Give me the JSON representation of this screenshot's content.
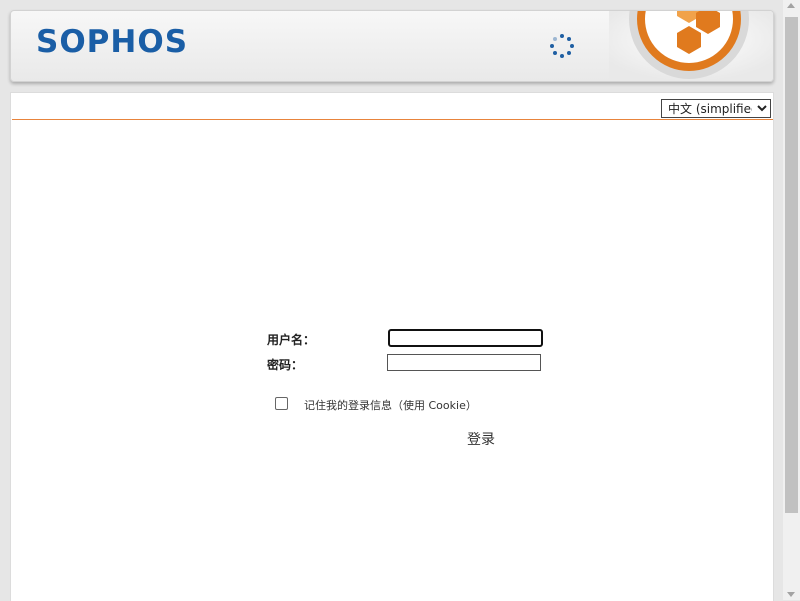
{
  "header": {
    "logo_text": "SOPHOS",
    "spinner_icon": "loading-spinner-icon",
    "brand_icon": "sophos-shield-hexagon-icon",
    "brand_color": "#1a5ea6",
    "accent_color": "#e8843c"
  },
  "language": {
    "selected": "中文 (simplified)"
  },
  "login": {
    "username_label": "用户名：",
    "password_label": "密码：",
    "username_value": "",
    "password_value": "",
    "remember_label": "记住我的登录信息（使用 Cookie）",
    "remember_checked": false,
    "submit_label": "登录"
  }
}
